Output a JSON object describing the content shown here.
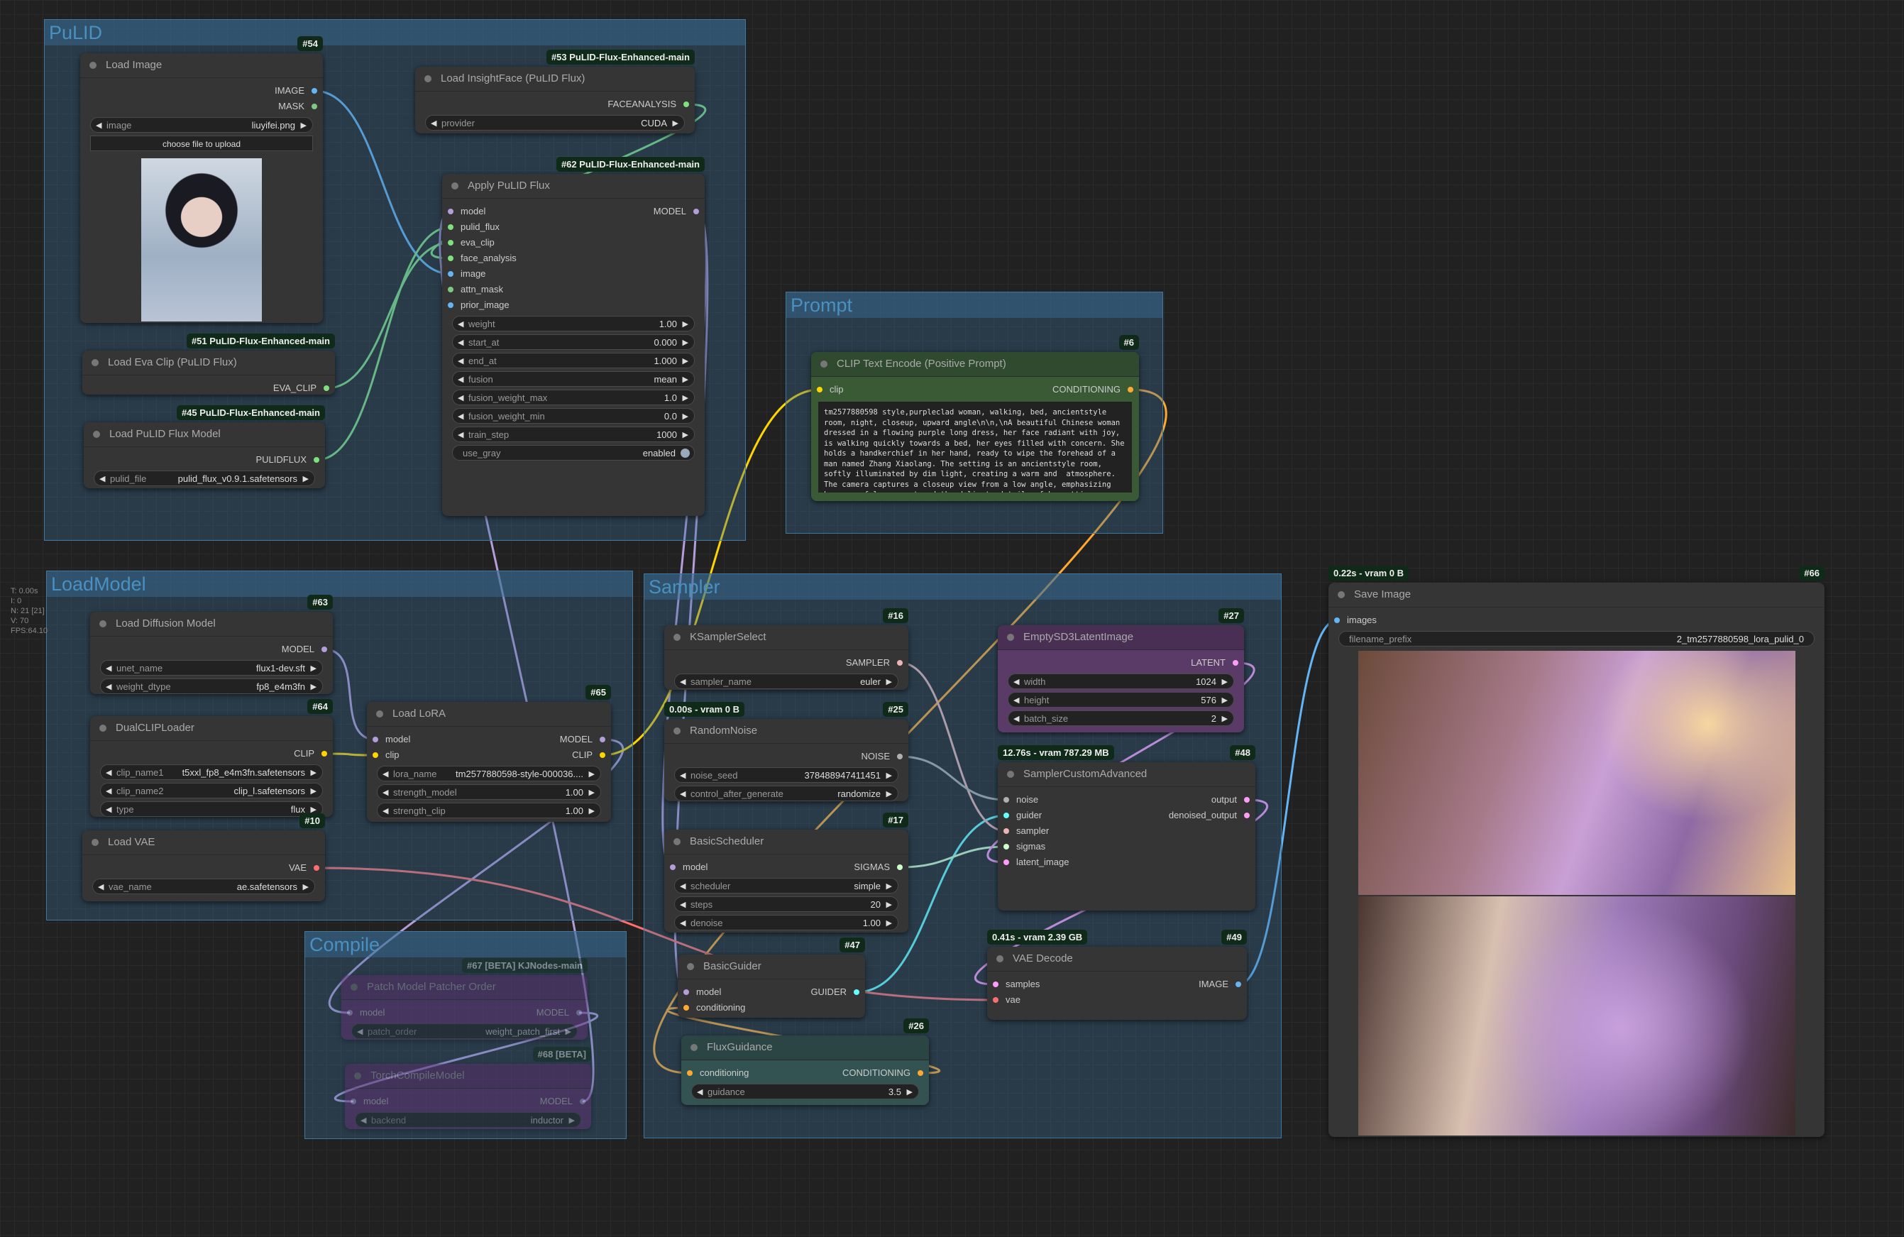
{
  "stats": [
    "T: 0.00s",
    "I: 0",
    "N: 21 [21]",
    "V: 70",
    "FPS:64.10"
  ],
  "groups": [
    {
      "id": "pulid",
      "title": "PuLID"
    },
    {
      "id": "prompt",
      "title": "Prompt"
    },
    {
      "id": "loadmodel",
      "title": "LoadModel"
    },
    {
      "id": "sampler",
      "title": "Sampler"
    },
    {
      "id": "compile",
      "title": "Compile"
    }
  ],
  "colors": {
    "MODEL": "#b39ddb",
    "CLIP": "#ffd500",
    "VAE": "#ff6e6e",
    "CONDITIONING": "#ffa931",
    "LATENT": "#ff9cf9",
    "IMAGE": "#64b5f6",
    "MASK": "#81c784",
    "GREEN": "#7ee07e",
    "SAMPLER": "#ecb4b4",
    "SIGMAS": "#cdffcd",
    "NOISE": "#b0b0b0",
    "GUIDER": "#66ffff",
    "node_bg": "#353535",
    "group": "#3f789e"
  },
  "nodes": [
    {
      "id": "n54",
      "title": "Load Image",
      "badge": "#54",
      "outputs": [
        {
          "name": "IMAGE",
          "t": "IMAGE"
        },
        {
          "name": "MASK",
          "t": "MASK"
        }
      ],
      "widgets": [
        {
          "name": "image",
          "value": "liuyifei.png"
        }
      ],
      "button": "choose file to upload",
      "image": "portrait"
    },
    {
      "id": "n53",
      "title": "Load InsightFace (PuLID Flux)",
      "badge": "#53 PuLID-Flux-Enhanced-main",
      "outputs": [
        {
          "name": "FACEANALYSIS",
          "t": "GREEN"
        }
      ],
      "widgets": [
        {
          "name": "provider",
          "value": "CUDA"
        }
      ]
    },
    {
      "id": "n62",
      "title": "Apply PuLID Flux",
      "badge": "#62 PuLID-Flux-Enhanced-main",
      "inputs": [
        {
          "name": "model",
          "t": "MODEL"
        },
        {
          "name": "pulid_flux",
          "t": "GREEN"
        },
        {
          "name": "eva_clip",
          "t": "GREEN"
        },
        {
          "name": "face_analysis",
          "t": "GREEN"
        },
        {
          "name": "image",
          "t": "IMAGE"
        },
        {
          "name": "attn_mask",
          "t": "MASK"
        },
        {
          "name": "prior_image",
          "t": "IMAGE"
        }
      ],
      "outputs": [
        {
          "name": "MODEL",
          "t": "MODEL"
        }
      ],
      "widgets": [
        {
          "name": "weight",
          "value": "1.00"
        },
        {
          "name": "start_at",
          "value": "0.000"
        },
        {
          "name": "end_at",
          "value": "1.000"
        },
        {
          "name": "fusion",
          "value": "mean"
        },
        {
          "name": "fusion_weight_max",
          "value": "1.0"
        },
        {
          "name": "fusion_weight_min",
          "value": "0.0"
        },
        {
          "name": "train_step",
          "value": "1000"
        },
        {
          "name": "use_gray",
          "value": "enabled",
          "toggle": true,
          "on": true
        }
      ]
    },
    {
      "id": "n51",
      "title": "Load Eva Clip (PuLID Flux)",
      "badge": "#51 PuLID-Flux-Enhanced-main",
      "outputs": [
        {
          "name": "EVA_CLIP",
          "t": "GREEN"
        }
      ]
    },
    {
      "id": "n45",
      "title": "Load PuLID Flux Model",
      "badge": "#45 PuLID-Flux-Enhanced-main",
      "outputs": [
        {
          "name": "PULIDFLUX",
          "t": "GREEN"
        }
      ],
      "widgets": [
        {
          "name": "pulid_file",
          "value": "pulid_flux_v0.9.1.safetensors"
        }
      ]
    },
    {
      "id": "n6",
      "title": "CLIP Text Encode (Positive Prompt)",
      "badge": "#6",
      "theme": "green",
      "inputs": [
        {
          "name": "clip",
          "t": "CLIP"
        }
      ],
      "outputs": [
        {
          "name": "CONDITIONING",
          "t": "CONDITIONING"
        }
      ],
      "text": "tm2577880598 style,purpleclad woman, walking, bed, ancientstyle room, night, closeup, upward angle\\n\\n,\\nA beautiful Chinese woman dressed in a flowing purple long dress, her face radiant with joy, is walking quickly towards a bed, her eyes filled with concern. She holds a handkerchief in her hand, ready to wipe the forehead of a man named Zhang Xiaolang. The setting is an ancientstyle room, softly illuminated by dim light, creating a warm and  atmosphere. The camera captures a closeup view from a low angle, emphasizing her graceful movement and the delicate details of her attire."
    },
    {
      "id": "n63",
      "title": "Load Diffusion Model",
      "badge": "#63",
      "outputs": [
        {
          "name": "MODEL",
          "t": "MODEL"
        }
      ],
      "widgets": [
        {
          "name": "unet_name",
          "value": "flux1-dev.sft"
        },
        {
          "name": "weight_dtype",
          "value": "fp8_e4m3fn"
        }
      ]
    },
    {
      "id": "n64",
      "title": "DualCLIPLoader",
      "badge": "#64",
      "outputs": [
        {
          "name": "CLIP",
          "t": "CLIP"
        }
      ],
      "widgets": [
        {
          "name": "clip_name1",
          "value": "t5xxl_fp8_e4m3fn.safetensors"
        },
        {
          "name": "clip_name2",
          "value": "clip_l.safetensors"
        },
        {
          "name": "type",
          "value": "flux"
        }
      ]
    },
    {
      "id": "n65",
      "title": "Load LoRA",
      "badge": "#65",
      "inputs": [
        {
          "name": "model",
          "t": "MODEL"
        },
        {
          "name": "clip",
          "t": "CLIP"
        }
      ],
      "outputs": [
        {
          "name": "MODEL",
          "t": "MODEL"
        },
        {
          "name": "CLIP",
          "t": "CLIP"
        }
      ],
      "widgets": [
        {
          "name": "lora_name",
          "value": "tm2577880598-style-000036...."
        },
        {
          "name": "strength_model",
          "value": "1.00"
        },
        {
          "name": "strength_clip",
          "value": "1.00"
        }
      ]
    },
    {
      "id": "n10",
      "title": "Load VAE",
      "badge": "#10",
      "outputs": [
        {
          "name": "VAE",
          "t": "VAE"
        }
      ],
      "widgets": [
        {
          "name": "vae_name",
          "value": "ae.safetensors"
        }
      ]
    },
    {
      "id": "n16",
      "title": "KSamplerSelect",
      "badge": "#16",
      "outputs": [
        {
          "name": "SAMPLER",
          "t": "SAMPLER"
        }
      ],
      "widgets": [
        {
          "name": "sampler_name",
          "value": "euler"
        }
      ]
    },
    {
      "id": "n25",
      "title": "RandomNoise",
      "badge": "#25",
      "timing": "0.00s - vram 0 B",
      "outputs": [
        {
          "name": "NOISE",
          "t": "NOISE"
        }
      ],
      "widgets": [
        {
          "name": "noise_seed",
          "value": "378488947411451"
        },
        {
          "name": "control_after_generate",
          "value": "randomize"
        }
      ]
    },
    {
      "id": "n17",
      "title": "BasicScheduler",
      "badge": "#17",
      "inputs": [
        {
          "name": "model",
          "t": "MODEL"
        }
      ],
      "outputs": [
        {
          "name": "SIGMAS",
          "t": "SIGMAS"
        }
      ],
      "widgets": [
        {
          "name": "scheduler",
          "value": "simple"
        },
        {
          "name": "steps",
          "value": "20"
        },
        {
          "name": "denoise",
          "value": "1.00"
        }
      ]
    },
    {
      "id": "n47",
      "title": "BasicGuider",
      "badge": "#47",
      "inputs": [
        {
          "name": "model",
          "t": "MODEL"
        },
        {
          "name": "conditioning",
          "t": "CONDITIONING"
        }
      ],
      "outputs": [
        {
          "name": "GUIDER",
          "t": "GUIDER"
        }
      ]
    },
    {
      "id": "n26",
      "title": "FluxGuidance",
      "badge": "#26",
      "theme": "teal",
      "inputs": [
        {
          "name": "conditioning",
          "t": "CONDITIONING"
        }
      ],
      "outputs": [
        {
          "name": "CONDITIONING",
          "t": "CONDITIONING"
        }
      ],
      "widgets": [
        {
          "name": "guidance",
          "value": "3.5"
        }
      ]
    },
    {
      "id": "n27",
      "title": "EmptySD3LatentImage",
      "badge": "#27",
      "theme": "purple",
      "outputs": [
        {
          "name": "LATENT",
          "t": "LATENT"
        }
      ],
      "widgets": [
        {
          "name": "width",
          "value": "1024"
        },
        {
          "name": "height",
          "value": "576"
        },
        {
          "name": "batch_size",
          "value": "2"
        }
      ]
    },
    {
      "id": "n48",
      "title": "SamplerCustomAdvanced",
      "badge": "#48",
      "timing": "12.76s - vram 787.29 MB",
      "inputs": [
        {
          "name": "noise",
          "t": "NOISE"
        },
        {
          "name": "guider",
          "t": "GUIDER"
        },
        {
          "name": "sampler",
          "t": "SAMPLER"
        },
        {
          "name": "sigmas",
          "t": "SIGMAS"
        },
        {
          "name": "latent_image",
          "t": "LATENT"
        }
      ],
      "outputs": [
        {
          "name": "output",
          "t": "LATENT"
        },
        {
          "name": "denoised_output",
          "t": "LATENT"
        }
      ]
    },
    {
      "id": "n49",
      "title": "VAE Decode",
      "badge": "#49",
      "timing": "0.41s - vram 2.39 GB",
      "inputs": [
        {
          "name": "samples",
          "t": "LATENT"
        },
        {
          "name": "vae",
          "t": "VAE"
        }
      ],
      "outputs": [
        {
          "name": "IMAGE",
          "t": "IMAGE"
        }
      ]
    },
    {
      "id": "n66",
      "title": "Save Image",
      "badge": "#66",
      "timing": "0.22s - vram 0 B",
      "inputs": [
        {
          "name": "images",
          "t": "IMAGE"
        }
      ],
      "widgets": [
        {
          "name": "filename_prefix",
          "value": "2_tm2577880598_lora_pulid_0",
          "text": true
        }
      ],
      "image": "output"
    },
    {
      "id": "n67",
      "title": "Patch Model Patcher Order",
      "badge": "#67 [BETA] KJNodes-main",
      "bypassed": true,
      "inputs": [
        {
          "name": "model",
          "t": "MODEL"
        }
      ],
      "outputs": [
        {
          "name": "MODEL",
          "t": "MODEL"
        }
      ],
      "widgets": [
        {
          "name": "patch_order",
          "value": "weight_patch_first"
        }
      ]
    },
    {
      "id": "n68",
      "title": "TorchCompileModel",
      "badge": "#68 [BETA]",
      "bypassed": true,
      "inputs": [
        {
          "name": "model",
          "t": "MODEL"
        }
      ],
      "outputs": [
        {
          "name": "MODEL",
          "t": "MODEL"
        }
      ],
      "widgets": [
        {
          "name": "backend",
          "value": "inductor"
        }
      ]
    }
  ]
}
